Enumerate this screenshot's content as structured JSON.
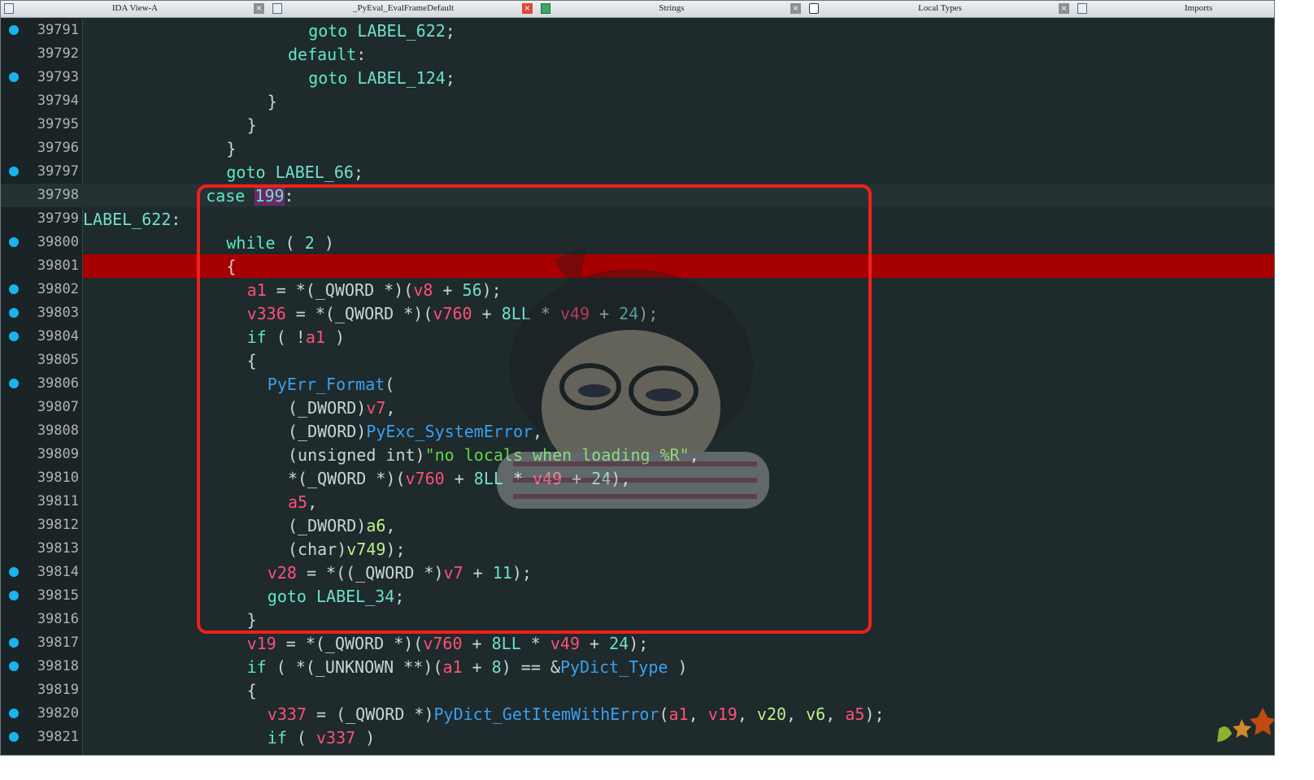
{
  "tabs": [
    {
      "label": "IDA View-A",
      "icon": "list-icon",
      "close": "×",
      "active": false
    },
    {
      "label": "_PyEval_EvalFrameDefault",
      "icon": "pseudocode-icon",
      "close": "×",
      "active": true
    },
    {
      "label": "Strings",
      "icon": "strings-icon",
      "close": "×",
      "active": false
    },
    {
      "label": "Local Types",
      "icon": "local-types-icon",
      "close": "×",
      "active": false
    },
    {
      "label": "Imports",
      "icon": "imports-icon",
      "close": "",
      "active": false
    }
  ],
  "lines": [
    {
      "no": "39791",
      "dot": true
    },
    {
      "no": "39792",
      "dot": false
    },
    {
      "no": "39793",
      "dot": true
    },
    {
      "no": "39794",
      "dot": false
    },
    {
      "no": "39795",
      "dot": false
    },
    {
      "no": "39796",
      "dot": false
    },
    {
      "no": "39797",
      "dot": true
    },
    {
      "no": "39798",
      "dot": false
    },
    {
      "no": "39799",
      "dot": false
    },
    {
      "no": "39800",
      "dot": true
    },
    {
      "no": "39801",
      "dot": false
    },
    {
      "no": "39802",
      "dot": true
    },
    {
      "no": "39803",
      "dot": true
    },
    {
      "no": "39804",
      "dot": true
    },
    {
      "no": "39805",
      "dot": false
    },
    {
      "no": "39806",
      "dot": true
    },
    {
      "no": "39807",
      "dot": false
    },
    {
      "no": "39808",
      "dot": false
    },
    {
      "no": "39809",
      "dot": false
    },
    {
      "no": "39810",
      "dot": false
    },
    {
      "no": "39811",
      "dot": false
    },
    {
      "no": "39812",
      "dot": false
    },
    {
      "no": "39813",
      "dot": false
    },
    {
      "no": "39814",
      "dot": true
    },
    {
      "no": "39815",
      "dot": true
    },
    {
      "no": "39816",
      "dot": false
    },
    {
      "no": "39817",
      "dot": true
    },
    {
      "no": "39818",
      "dot": true
    },
    {
      "no": "39819",
      "dot": false
    },
    {
      "no": "39820",
      "dot": true
    },
    {
      "no": "39821",
      "dot": true
    }
  ],
  "code": {
    "l39791": {
      "kw": "goto",
      "lbl": "LABEL_622",
      "end": ";"
    },
    "l39792": {
      "kw": "default",
      "end": ":"
    },
    "l39793": {
      "kw": "goto",
      "lbl": "LABEL_124",
      "end": ";"
    },
    "l39794": {
      "t": "}"
    },
    "l39795": {
      "t": "}"
    },
    "l39796": {
      "t": "}"
    },
    "l39797": {
      "kw": "goto",
      "lbl": "LABEL_66",
      "end": ";"
    },
    "l39798": {
      "kw": "case",
      "num": "199",
      "end": ":"
    },
    "l39799": {
      "lbl": "LABEL_622",
      "end": ":"
    },
    "l39800": {
      "kw": "while",
      "a": " ( ",
      "num": "2",
      "b": " )"
    },
    "l39801": {
      "t": "{"
    },
    "l39802": {
      "v1": "a1",
      "a": " = *(_QWORD *)(",
      "v2": "v8",
      "b": " + ",
      "n": "56",
      "c": ");"
    },
    "l39803": {
      "v1": "v336",
      "a": " = *(_QWORD *)(",
      "v2": "v760",
      "b": " + ",
      "n": "8LL",
      "c": " * ",
      "v3": "v49",
      "d": " + ",
      "n2": "24",
      "e": ");"
    },
    "l39804": {
      "kw": "if",
      "a": " ( !",
      "v1": "a1",
      "b": " )"
    },
    "l39805": {
      "t": "{"
    },
    "l39806": {
      "fn": "PyErr_Format",
      "a": "("
    },
    "l39807": {
      "a": "(_DWORD)",
      "v1": "v7",
      "b": ","
    },
    "l39808": {
      "a": "(_DWORD)",
      "fn": "PyExc_SystemError",
      "b": ","
    },
    "l39809": {
      "a": "(unsigned int)",
      "str": "\"no locals when loading %R\"",
      "b": ","
    },
    "l39810": {
      "a": "*(_QWORD *)(",
      "v1": "v760",
      "b": " + ",
      "n": "8LL",
      "c": " * ",
      "v2": "v49",
      "d": " + ",
      "n2": "24",
      "e": "),"
    },
    "l39811": {
      "v1": "a5",
      "a": ","
    },
    "l39812": {
      "a": "(_DWORD)",
      "g": "a6",
      "b": ","
    },
    "l39813": {
      "a": "(char)",
      "g": "v749",
      "b": ");"
    },
    "l39814": {
      "v1": "v28",
      "a": " = *((_QWORD *)",
      "v2": "v7",
      "b": " + ",
      "n": "11",
      "c": ");"
    },
    "l39815": {
      "kw": "goto",
      "lbl": "LABEL_34",
      "end": ";"
    },
    "l39816": {
      "t": "}"
    },
    "l39817": {
      "v1": "v19",
      "a": " = *(_QWORD *)(",
      "v2": "v760",
      "b": " + ",
      "n": "8LL",
      "c": " * ",
      "v3": "v49",
      "d": " + ",
      "n2": "24",
      "e": ");"
    },
    "l39818": {
      "kw": "if",
      "a": " ( *(_UNKNOWN **)(",
      "v1": "a1",
      "b": " + ",
      "n": "8",
      "c": ") == &",
      "fn": "PyDict_Type",
      "d": " )"
    },
    "l39819": {
      "t": "{"
    },
    "l39820": {
      "v1": "v337",
      "a": " = (_QWORD *)",
      "fn": "PyDict_GetItemWithError",
      "b": "(",
      "v2": "a1",
      "c": ", ",
      "v3": "v19",
      "d": ", ",
      "g1": "v20",
      "e": ", ",
      "g2": "v6",
      "f": ", ",
      "v4": "a5",
      "h": ");"
    },
    "l39821": {
      "kw": "if",
      "a": " ( ",
      "v1": "v337",
      "b": " )"
    }
  },
  "colors": {
    "background": "#1e2a2c",
    "keyword": "#5ee8c4",
    "variable": "#ff4f78",
    "function": "#3aa0f0",
    "string": "#66d24a",
    "breakpoint_line": "#a80000",
    "breakpoint_dot": "#18b4f0",
    "highlight_box": "#f0201a"
  }
}
